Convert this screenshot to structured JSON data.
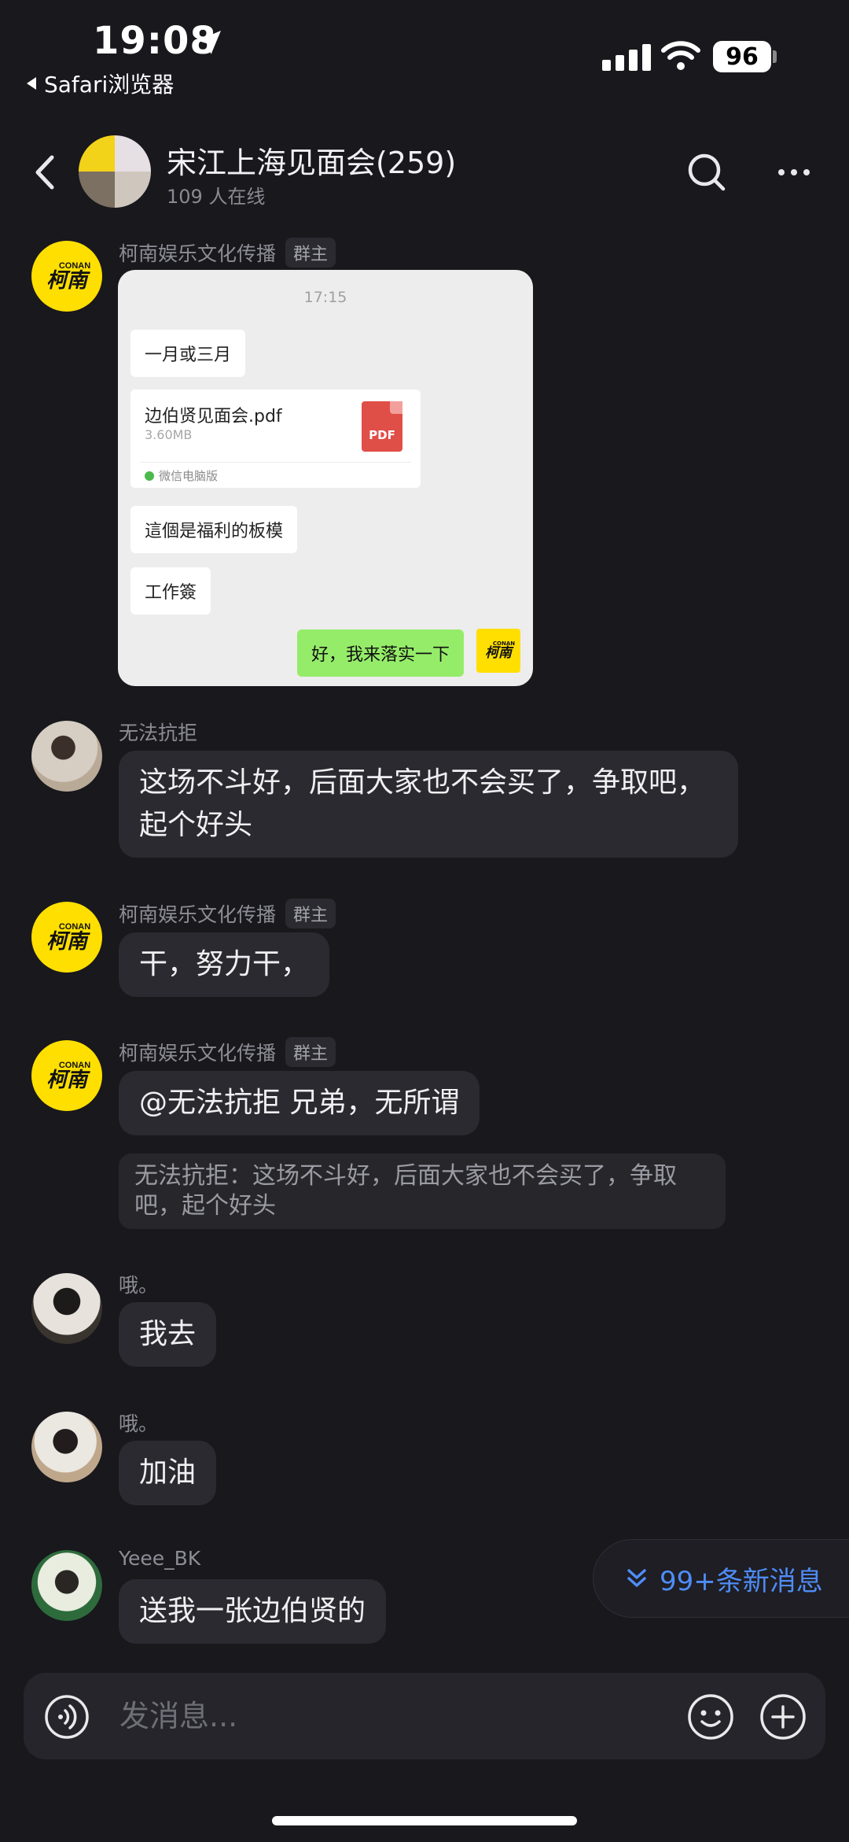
{
  "status_bar": {
    "time": "19:08",
    "back_app": "Safari浏览器",
    "battery": "96"
  },
  "header": {
    "title": "宋江上海见面会(259)",
    "subtitle": "109 人在线"
  },
  "messages": [
    {
      "sender": "柯南娱乐文化传播",
      "role": "群主",
      "avatar_text": {
        "small": "CONAN",
        "big": "柯南"
      },
      "image_card": {
        "time": "17:15",
        "bubble1": "一月或三月",
        "file_name": "边伯贤见面会.pdf",
        "file_size": "3.60MB",
        "file_icon": "PDF",
        "file_source": "微信电脑版",
        "bubble2": "這個是福利的板模",
        "bubble3": "工作簽",
        "reply": "好，我来落实一下",
        "self_avatar": {
          "small": "CONAN",
          "big": "柯南"
        }
      }
    },
    {
      "sender": "无法抗拒",
      "text": "这场不斗好，后面大家也不会买了，争取吧，起个好头"
    },
    {
      "sender": "柯南娱乐文化传播",
      "role": "群主",
      "avatar_text": {
        "small": "CONAN",
        "big": "柯南"
      },
      "text": "干，努力干，"
    },
    {
      "sender": "柯南娱乐文化传播",
      "role": "群主",
      "avatar_text": {
        "small": "CONAN",
        "big": "柯南"
      },
      "text": "@无法抗拒 兄弟，无所谓",
      "quote": "无法抗拒：这场不斗好，后面大家也不会买了，争取吧，起个好头"
    },
    {
      "sender": "哦。",
      "text": "我去"
    },
    {
      "sender": "哦。",
      "text": "加油"
    },
    {
      "sender": "Yeee_BK",
      "text": "送我一张边伯贤的"
    }
  ],
  "new_messages": "99+条新消息",
  "input": {
    "placeholder": "发消息..."
  },
  "colors": {
    "background": "#18181d",
    "bubble": "#2a2a30",
    "accent": "#4f8cf7",
    "conan_yellow": "#ffdf00",
    "wechat_green": "#95ec69"
  },
  "icons": [
    "location-arrow-icon",
    "signal-icon",
    "wifi-icon",
    "back-chevron-icon",
    "search-icon",
    "more-icon",
    "double-chevron-down-icon",
    "voice-icon",
    "emoji-icon",
    "plus-icon"
  ]
}
